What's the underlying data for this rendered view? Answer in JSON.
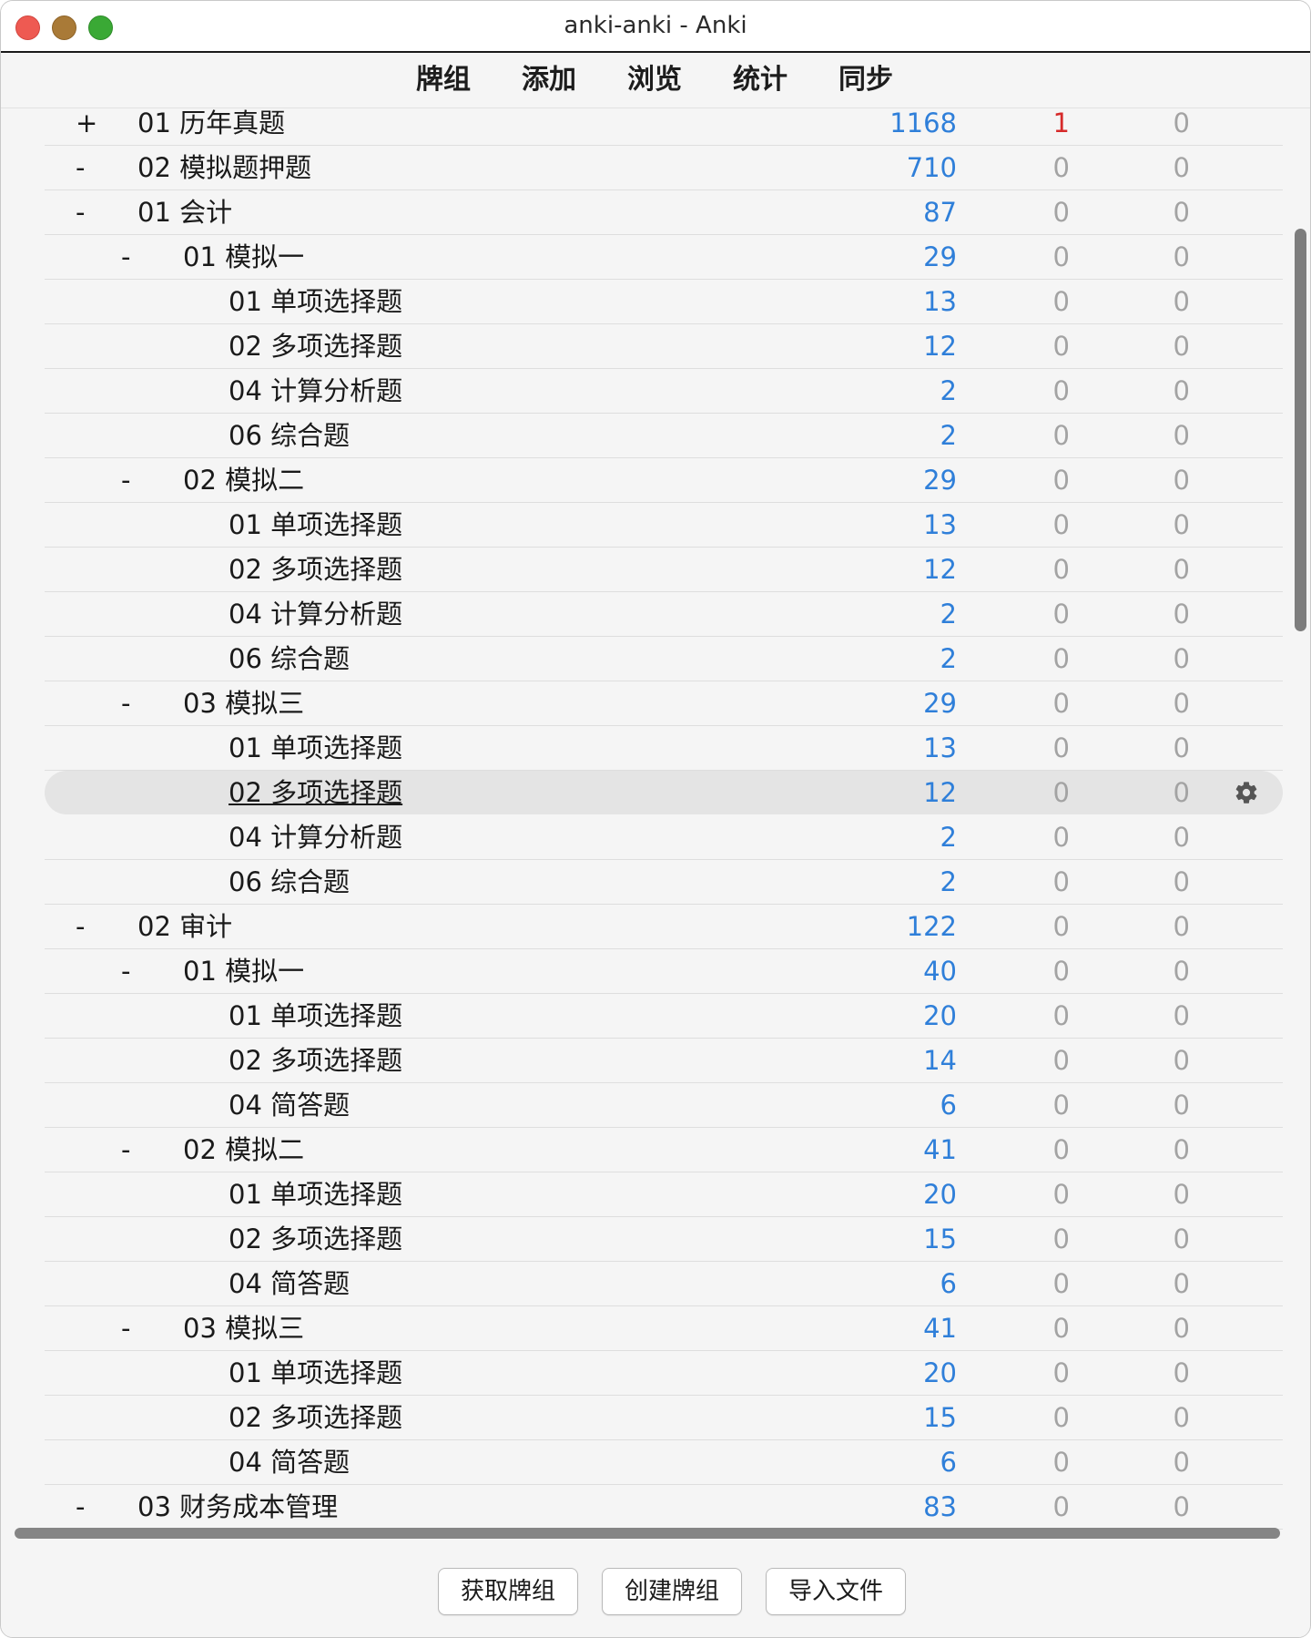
{
  "window": {
    "title": "anki-anki - Anki"
  },
  "toolbar": {
    "decks": "牌组",
    "add": "添加",
    "browse": "浏览",
    "stats": "统计",
    "sync": "同步"
  },
  "decks": [
    {
      "toggle": "+",
      "name": "01 历年真题",
      "new": "1168",
      "learn": "1",
      "due": "0",
      "learn_color": "#d62a2a"
    },
    {
      "toggle": "-",
      "name": "02 模拟题押题",
      "new": "710",
      "learn": "0",
      "due": "0"
    },
    {
      "toggle": "-",
      "name": "01 会计",
      "new": "87",
      "learn": "0",
      "due": "0"
    },
    {
      "toggle": "-",
      "name": "01 模拟一",
      "new": "29",
      "learn": "0",
      "due": "0"
    },
    {
      "toggle": "",
      "name": "01 单项选择题",
      "new": "13",
      "learn": "0",
      "due": "0"
    },
    {
      "toggle": "",
      "name": "02 多项选择题",
      "new": "12",
      "learn": "0",
      "due": "0"
    },
    {
      "toggle": "",
      "name": "04 计算分析题",
      "new": "2",
      "learn": "0",
      "due": "0"
    },
    {
      "toggle": "",
      "name": "06 综合题",
      "new": "2",
      "learn": "0",
      "due": "0"
    },
    {
      "toggle": "-",
      "name": "02 模拟二",
      "new": "29",
      "learn": "0",
      "due": "0"
    },
    {
      "toggle": "",
      "name": "01 单项选择题",
      "new": "13",
      "learn": "0",
      "due": "0"
    },
    {
      "toggle": "",
      "name": "02 多项选择题",
      "new": "12",
      "learn": "0",
      "due": "0"
    },
    {
      "toggle": "",
      "name": "04 计算分析题",
      "new": "2",
      "learn": "0",
      "due": "0"
    },
    {
      "toggle": "",
      "name": "06 综合题",
      "new": "2",
      "learn": "0",
      "due": "0"
    },
    {
      "toggle": "-",
      "name": "03 模拟三",
      "new": "29",
      "learn": "0",
      "due": "0"
    },
    {
      "toggle": "",
      "name": "01 单项选择题",
      "new": "13",
      "learn": "0",
      "due": "0"
    },
    {
      "toggle": "",
      "name": "02 多项选择题",
      "new": "12",
      "learn": "0",
      "due": "0",
      "current": true
    },
    {
      "toggle": "",
      "name": "04 计算分析题",
      "new": "2",
      "learn": "0",
      "due": "0"
    },
    {
      "toggle": "",
      "name": "06 综合题",
      "new": "2",
      "learn": "0",
      "due": "0"
    },
    {
      "toggle": "-",
      "name": "02 审计",
      "new": "122",
      "learn": "0",
      "due": "0"
    },
    {
      "toggle": "-",
      "name": "01 模拟一",
      "new": "40",
      "learn": "0",
      "due": "0"
    },
    {
      "toggle": "",
      "name": "01 单项选择题",
      "new": "20",
      "learn": "0",
      "due": "0"
    },
    {
      "toggle": "",
      "name": "02 多项选择题",
      "new": "14",
      "learn": "0",
      "due": "0"
    },
    {
      "toggle": "",
      "name": "04 简答题",
      "new": "6",
      "learn": "0",
      "due": "0"
    },
    {
      "toggle": "-",
      "name": "02 模拟二",
      "new": "41",
      "learn": "0",
      "due": "0"
    },
    {
      "toggle": "",
      "name": "01 单项选择题",
      "new": "20",
      "learn": "0",
      "due": "0"
    },
    {
      "toggle": "",
      "name": "02 多项选择题",
      "new": "15",
      "learn": "0",
      "due": "0"
    },
    {
      "toggle": "",
      "name": "04 简答题",
      "new": "6",
      "learn": "0",
      "due": "0"
    },
    {
      "toggle": "-",
      "name": "03 模拟三",
      "new": "41",
      "learn": "0",
      "due": "0"
    },
    {
      "toggle": "",
      "name": "01 单项选择题",
      "new": "20",
      "learn": "0",
      "due": "0"
    },
    {
      "toggle": "",
      "name": "02 多项选择题",
      "new": "15",
      "learn": "0",
      "due": "0"
    },
    {
      "toggle": "",
      "name": "04 简答题",
      "new": "6",
      "learn": "0",
      "due": "0"
    },
    {
      "toggle": "-",
      "name": "03 财务成本管理",
      "new": "83",
      "learn": "0",
      "due": "0"
    }
  ],
  "buttons": {
    "get_shared": "获取牌组",
    "create_deck": "创建牌组",
    "import_file": "导入文件"
  },
  "colors": {
    "new_count": "#2f7fd9",
    "learn_alert": "#d62a2a",
    "zero_count": "#a3a3a3"
  },
  "icons": {
    "deck_options": "gear-icon"
  }
}
